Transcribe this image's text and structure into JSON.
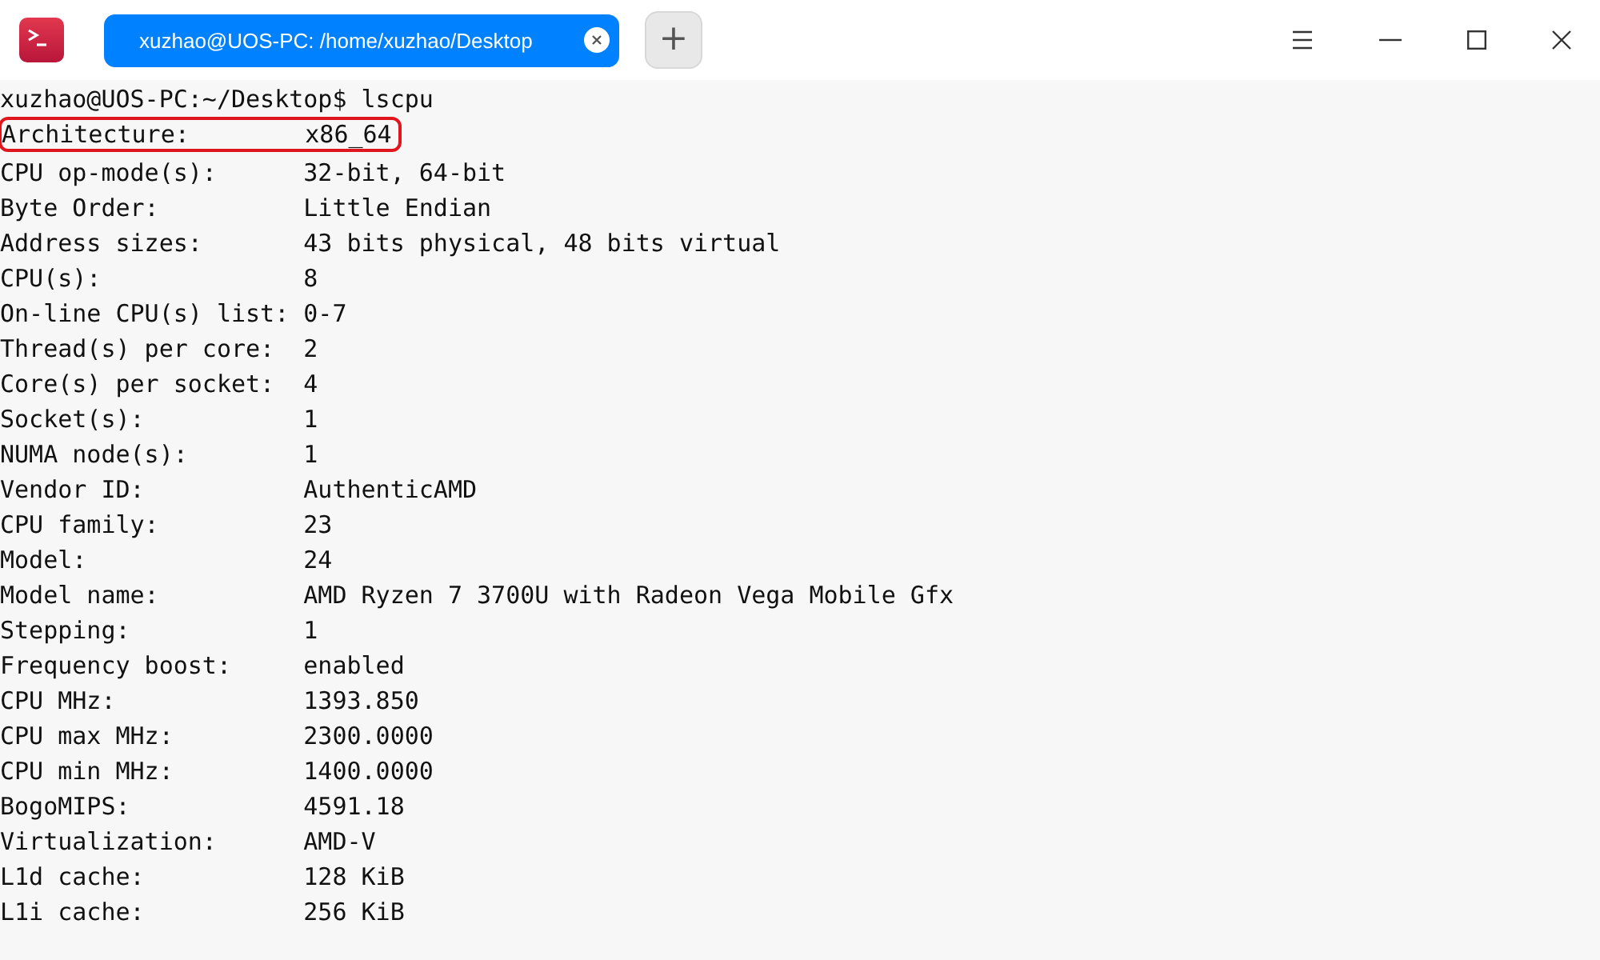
{
  "window": {
    "tab": {
      "title": "xuzhao@UOS-PC: /home/xuzhao/Desktop",
      "selected": true
    },
    "new_tab": "+"
  },
  "terminal": {
    "prompt": "xuzhao@UOS-PC:~/Desktop$ lscpu",
    "lines": [
      {
        "label": "Architecture:",
        "value": "x86_64",
        "highlighted": true
      },
      {
        "label": "CPU op-mode(s):",
        "value": "32-bit, 64-bit",
        "highlighted": false
      },
      {
        "label": "Byte Order:",
        "value": "Little Endian",
        "highlighted": false
      },
      {
        "label": "Address sizes:",
        "value": "43 bits physical, 48 bits virtual",
        "highlighted": false
      },
      {
        "label": "CPU(s):",
        "value": "8",
        "highlighted": false
      },
      {
        "label": "On-line CPU(s) list:",
        "value": "0-7",
        "highlighted": false
      },
      {
        "label": "Thread(s) per core:",
        "value": "2",
        "highlighted": false
      },
      {
        "label": "Core(s) per socket:",
        "value": "4",
        "highlighted": false
      },
      {
        "label": "Socket(s):",
        "value": "1",
        "highlighted": false
      },
      {
        "label": "NUMA node(s):",
        "value": "1",
        "highlighted": false
      },
      {
        "label": "Vendor ID:",
        "value": "AuthenticAMD",
        "highlighted": false
      },
      {
        "label": "CPU family:",
        "value": "23",
        "highlighted": false
      },
      {
        "label": "Model:",
        "value": "24",
        "highlighted": false
      },
      {
        "label": "Model name:",
        "value": "AMD Ryzen 7 3700U with Radeon Vega Mobile Gfx",
        "highlighted": false
      },
      {
        "label": "Stepping:",
        "value": "1",
        "highlighted": false
      },
      {
        "label": "Frequency boost:",
        "value": "enabled",
        "highlighted": false
      },
      {
        "label": "CPU MHz:",
        "value": "1393.850",
        "highlighted": false
      },
      {
        "label": "CPU max MHz:",
        "value": "2300.0000",
        "highlighted": false
      },
      {
        "label": "CPU min MHz:",
        "value": "1400.0000",
        "highlighted": false
      },
      {
        "label": "BogoMIPS:",
        "value": "4591.18",
        "highlighted": false
      },
      {
        "label": "Virtualization:",
        "value": "AMD-V",
        "highlighted": false
      },
      {
        "label": "L1d cache:",
        "value": "128 KiB",
        "highlighted": false
      },
      {
        "label": "L1i cache:",
        "value": "256 KiB",
        "highlighted": false
      }
    ]
  }
}
